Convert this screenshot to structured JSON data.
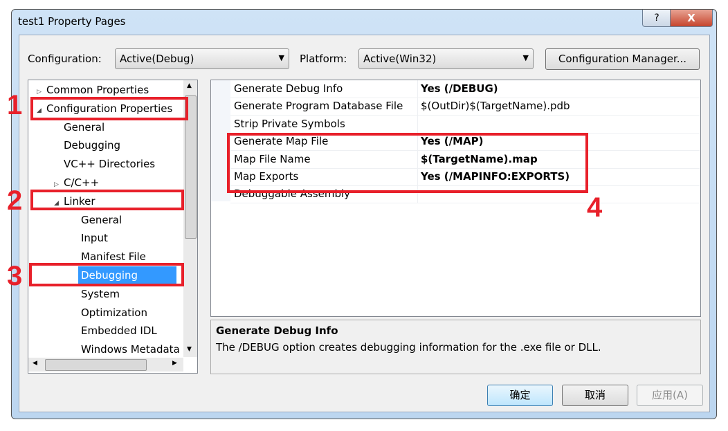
{
  "window": {
    "title": "test1 Property Pages",
    "help": "?",
    "close": "X"
  },
  "toolbar": {
    "config_label": "Configuration:",
    "config_value": "Active(Debug)",
    "platform_label": "Platform:",
    "platform_value": "Active(Win32)",
    "config_manager": "Configuration Manager..."
  },
  "tree": [
    {
      "label": "Common Properties",
      "twisty": "▷",
      "level": 0
    },
    {
      "label": "Configuration Properties",
      "twisty": "◢",
      "level": 0
    },
    {
      "label": "General",
      "twisty": "",
      "level": 1
    },
    {
      "label": "Debugging",
      "twisty": "",
      "level": 1
    },
    {
      "label": "VC++ Directories",
      "twisty": "",
      "level": 1
    },
    {
      "label": "C/C++",
      "twisty": "▷",
      "level": 1
    },
    {
      "label": "Linker",
      "twisty": "◢",
      "level": 1
    },
    {
      "label": "General",
      "twisty": "",
      "level": 2
    },
    {
      "label": "Input",
      "twisty": "",
      "level": 2
    },
    {
      "label": "Manifest File",
      "twisty": "",
      "level": 2
    },
    {
      "label": "Debugging",
      "twisty": "",
      "level": 2,
      "selected": true
    },
    {
      "label": "System",
      "twisty": "",
      "level": 2
    },
    {
      "label": "Optimization",
      "twisty": "",
      "level": 2
    },
    {
      "label": "Embedded IDL",
      "twisty": "",
      "level": 2
    },
    {
      "label": "Windows Metadata",
      "twisty": "",
      "level": 2
    }
  ],
  "properties": [
    {
      "name": "Generate Debug Info",
      "value": "Yes (/DEBUG)",
      "bold": true
    },
    {
      "name": "Generate Program Database File",
      "value": "$(OutDir)$(TargetName).pdb",
      "bold": false
    },
    {
      "name": "Strip Private Symbols",
      "value": "",
      "bold": false
    },
    {
      "name": "Generate Map File",
      "value": "Yes (/MAP)",
      "bold": true
    },
    {
      "name": "Map File Name",
      "value": "$(TargetName).map",
      "bold": true
    },
    {
      "name": "Map Exports",
      "value": "Yes (/MAPINFO:EXPORTS)",
      "bold": true
    },
    {
      "name": "Debuggable Assembly",
      "value": "",
      "bold": false
    }
  ],
  "description": {
    "title": "Generate Debug Info",
    "text": "The /DEBUG option creates debugging information for the .exe file or DLL."
  },
  "buttons": {
    "ok": "确定",
    "cancel": "取消",
    "apply": "应用(A)"
  },
  "annotations": {
    "n1": "1",
    "n2": "2",
    "n3": "3",
    "n4": "4",
    "color": "#e8202a"
  },
  "accent": "#3399ff"
}
